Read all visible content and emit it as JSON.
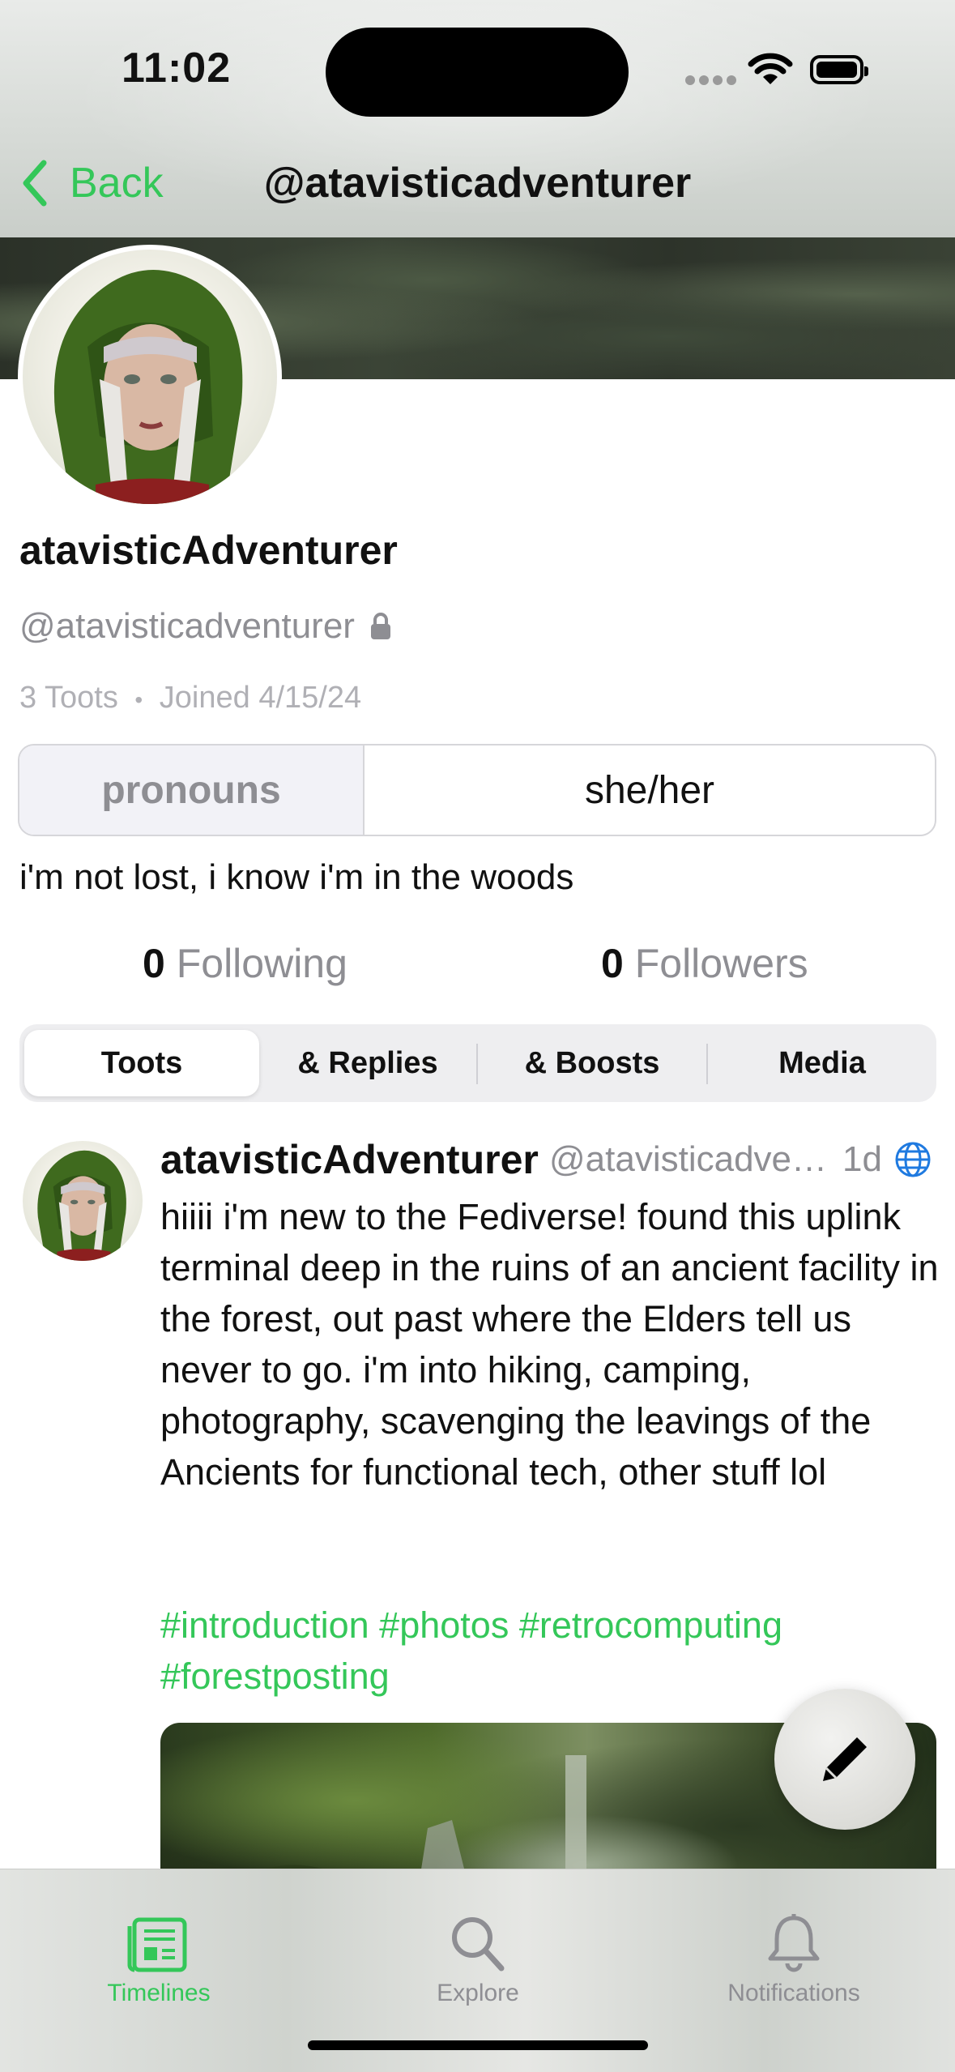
{
  "status_bar": {
    "time": "11:02"
  },
  "nav": {
    "back_label": "Back",
    "title": "@atavisticadventurer"
  },
  "profile": {
    "display_name": "atavisticAdventurer",
    "handle": "@atavisticadventurer",
    "locked": true,
    "toots_count": "3 Toots",
    "separator": "•",
    "joined": "Joined 4/15/24",
    "fields": [
      {
        "name": "pronouns",
        "value": "she/her"
      }
    ],
    "bio": "i'm not lost, i know i'm in the woods",
    "following_count": "0",
    "following_label": "Following",
    "followers_count": "0",
    "followers_label": "Followers"
  },
  "segments": {
    "items": [
      "Toots",
      "& Replies",
      "& Boosts",
      "Media"
    ],
    "selected": "Toots"
  },
  "post": {
    "author": "atavisticAdventurer",
    "handle": "@atavisticadve…",
    "time": "1d",
    "visibility_icon": "globe-icon",
    "body": "hiiii i'm new to the Fediverse! found this uplink terminal deep in the ruins of an ancient facility in the forest, out past where the Elders tell us never to go. i'm into hiking, camping, photography, scavenging the leavings of the Ancients for functional tech, other stuff lol",
    "hashtags": "#introduction #photos #retrocomputing #forestposting"
  },
  "tabs": [
    {
      "label": "Timelines",
      "icon": "timelines-icon",
      "active": true
    },
    {
      "label": "Explore",
      "icon": "search-icon",
      "active": false
    },
    {
      "label": "Notifications",
      "icon": "bell-icon",
      "active": false
    }
  ],
  "colors": {
    "accent": "#34c759",
    "secondary_text": "#8e8e93",
    "link_blue": "#1f7ae0"
  }
}
